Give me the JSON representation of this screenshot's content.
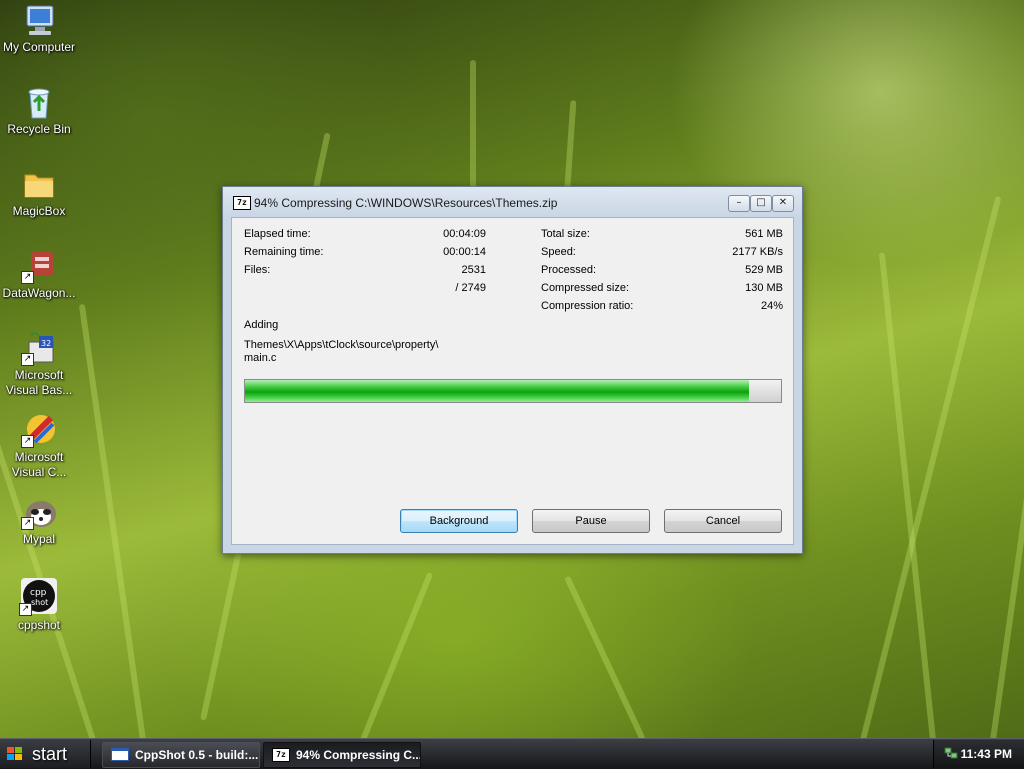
{
  "desktop": {
    "icons": [
      {
        "label": "My Computer",
        "icon": "computer-icon"
      },
      {
        "label": "Recycle Bin",
        "icon": "recycle-bin-icon"
      },
      {
        "label": "MagicBox",
        "icon": "folder-icon"
      },
      {
        "label": "DataWagon...",
        "icon": "datawagon-icon"
      },
      {
        "label": "Microsoft Visual Bas...",
        "icon": "visual-basic-icon"
      },
      {
        "label": "Microsoft Visual C...",
        "icon": "visual-c-icon"
      },
      {
        "label": "Mypal",
        "icon": "mypal-icon"
      },
      {
        "label": "cppshot",
        "icon": "cppshot-icon"
      }
    ]
  },
  "dialog": {
    "title": "94% Compressing C:\\WINDOWS\\Resources\\Themes.zip",
    "title_icon_text": "7z",
    "window_buttons": {
      "minimize": "–",
      "maximize": "□",
      "close": "✕"
    },
    "stats_left": [
      {
        "label": "Elapsed time:",
        "value": "00:04:09"
      },
      {
        "label": "Remaining time:",
        "value": "00:00:14"
      },
      {
        "label": "Files:",
        "value": "2531"
      },
      {
        "label": "",
        "value": "/ 2749"
      }
    ],
    "stats_right": [
      {
        "label": "Total size:",
        "value": "561 MB"
      },
      {
        "label": "Speed:",
        "value": "2177 KB/s"
      },
      {
        "label": "Processed:",
        "value": "529 MB"
      },
      {
        "label": "Compressed size:",
        "value": "130 MB"
      },
      {
        "label": "Compression ratio:",
        "value": "24%"
      }
    ],
    "status": "Adding",
    "current_file_line1": "Themes\\X\\Apps\\tClock\\source\\property\\",
    "current_file_line2": "main.c",
    "progress_percent": 94,
    "buttons": {
      "background": "Background",
      "pause": "Pause",
      "cancel": "Cancel"
    }
  },
  "taskbar": {
    "start_label": "start",
    "tasks": [
      {
        "label": "CppShot 0.5 - build:...",
        "active": false
      },
      {
        "label": "94% Compressing C...",
        "active": true
      }
    ],
    "clock": "11:43 PM"
  },
  "colors": {
    "progress_fill": "#18b018",
    "default_button_border": "#3c7fb1"
  }
}
